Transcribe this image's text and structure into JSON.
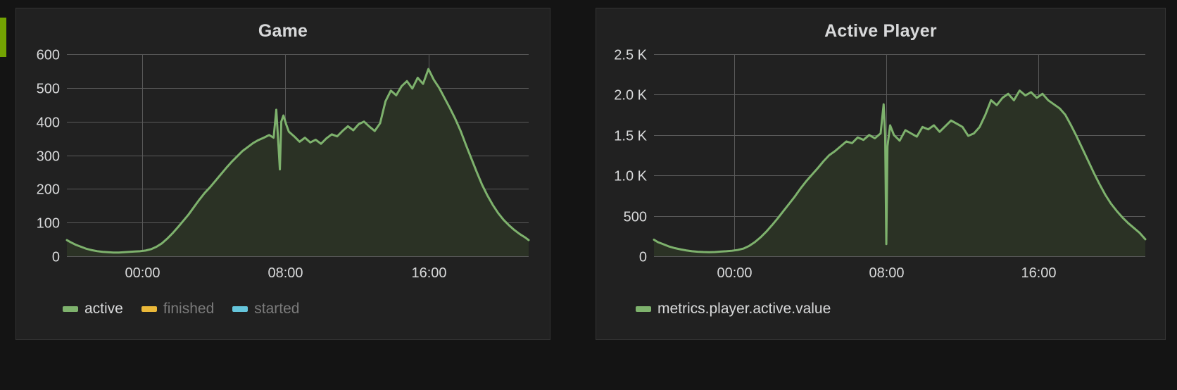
{
  "theme": {
    "page_background": "#141414",
    "panel_background": "#212121",
    "panel_border": "#343434",
    "accent_bar_color": "#73a302",
    "text_primary": "#d8d9da",
    "text_dimmed": "#7b7b7b",
    "grid_color": "#5a5a5a"
  },
  "panels": [
    {
      "id": "game",
      "title": "Game",
      "legend": [
        {
          "label": "active",
          "color": "#7eb26d",
          "enabled": true
        },
        {
          "label": "finished",
          "color": "#eab839",
          "enabled": false
        },
        {
          "label": "started",
          "color": "#65c5db",
          "enabled": false
        }
      ]
    },
    {
      "id": "active-player",
      "title": "Active Player",
      "legend": [
        {
          "label": "metrics.player.active.value",
          "color": "#7eb26d",
          "enabled": true
        }
      ]
    }
  ],
  "chart_data": [
    {
      "type": "area",
      "panel": "game",
      "title": "Game",
      "xlabel": "",
      "ylabel": "",
      "grid": true,
      "legend_position": "bottom",
      "ylim": [
        0,
        600
      ],
      "yticks": [
        0,
        100,
        200,
        300,
        400,
        500,
        600
      ],
      "yticklabels": [
        "0",
        "100",
        "200",
        "300",
        "400",
        "500",
        "600"
      ],
      "xlim": [
        -4.2,
        21.6
      ],
      "xticks": [
        0,
        8,
        16
      ],
      "xticklabels": [
        "00:00",
        "08:00",
        "16:00"
      ],
      "series": [
        {
          "name": "active",
          "color": "#7eb26d",
          "fill": "#2b3225",
          "x": [
            -4.2,
            -4.0,
            -3.7,
            -3.4,
            -3.1,
            -2.8,
            -2.5,
            -2.2,
            -1.9,
            -1.6,
            -1.3,
            -1.0,
            -0.7,
            -0.4,
            -0.1,
            0.2,
            0.5,
            0.8,
            1.1,
            1.4,
            1.7,
            2.0,
            2.3,
            2.6,
            2.9,
            3.2,
            3.5,
            3.8,
            4.1,
            4.4,
            4.7,
            5.0,
            5.3,
            5.6,
            5.9,
            6.2,
            6.5,
            6.8,
            7.1,
            7.35,
            7.5,
            7.62,
            7.7,
            7.78,
            7.9,
            8.05,
            8.2,
            8.5,
            8.8,
            9.1,
            9.4,
            9.7,
            10.0,
            10.3,
            10.6,
            10.9,
            11.2,
            11.5,
            11.8,
            12.1,
            12.4,
            12.7,
            13.0,
            13.3,
            13.6,
            13.9,
            14.2,
            14.5,
            14.8,
            15.1,
            15.4,
            15.7,
            16.0,
            16.3,
            16.6,
            16.9,
            17.2,
            17.5,
            17.8,
            18.1,
            18.4,
            18.7,
            19.0,
            19.3,
            19.6,
            19.9,
            20.2,
            20.5,
            20.8,
            21.1,
            21.4,
            21.6
          ],
          "y": [
            48,
            42,
            34,
            28,
            22,
            18,
            15,
            13,
            12,
            11,
            11,
            12,
            13,
            14,
            15,
            17,
            21,
            28,
            38,
            52,
            68,
            86,
            105,
            124,
            146,
            168,
            188,
            205,
            224,
            243,
            262,
            280,
            296,
            312,
            324,
            336,
            345,
            352,
            360,
            352,
            435,
            330,
            258,
            400,
            418,
            392,
            370,
            356,
            340,
            352,
            338,
            346,
            334,
            350,
            362,
            356,
            372,
            386,
            374,
            392,
            400,
            385,
            372,
            395,
            460,
            492,
            478,
            505,
            520,
            498,
            530,
            512,
            556,
            524,
            500,
            470,
            440,
            408,
            372,
            330,
            290,
            250,
            212,
            180,
            152,
            128,
            108,
            92,
            78,
            66,
            56,
            48
          ]
        }
      ]
    },
    {
      "type": "area",
      "panel": "active-player",
      "title": "Active Player",
      "xlabel": "",
      "ylabel": "",
      "grid": true,
      "legend_position": "bottom",
      "ylim": [
        0,
        2500
      ],
      "yticks": [
        0,
        500,
        1000,
        1500,
        2000,
        2500
      ],
      "yticklabels": [
        "0",
        "500",
        "1.0 K",
        "1.5 K",
        "2.0 K",
        "2.5 K"
      ],
      "xlim": [
        -4.2,
        21.6
      ],
      "xticks": [
        0,
        8,
        16
      ],
      "xticklabels": [
        "00:00",
        "08:00",
        "16:00"
      ],
      "series": [
        {
          "name": "metrics.player.active.value",
          "color": "#7eb26d",
          "fill": "#2b3225",
          "x": [
            -4.2,
            -4.0,
            -3.7,
            -3.4,
            -3.1,
            -2.8,
            -2.5,
            -2.2,
            -1.9,
            -1.6,
            -1.3,
            -1.0,
            -0.7,
            -0.4,
            -0.1,
            0.2,
            0.5,
            0.8,
            1.1,
            1.4,
            1.7,
            2.0,
            2.3,
            2.6,
            2.9,
            3.2,
            3.5,
            3.8,
            4.1,
            4.4,
            4.7,
            5.0,
            5.3,
            5.6,
            5.9,
            6.2,
            6.5,
            6.8,
            7.1,
            7.4,
            7.7,
            7.86,
            7.94,
            8.0,
            8.06,
            8.2,
            8.4,
            8.7,
            9.0,
            9.3,
            9.6,
            9.9,
            10.2,
            10.5,
            10.8,
            11.1,
            11.4,
            11.7,
            12.0,
            12.3,
            12.6,
            12.9,
            13.2,
            13.5,
            13.8,
            14.1,
            14.4,
            14.7,
            15.0,
            15.3,
            15.6,
            15.9,
            16.2,
            16.5,
            16.8,
            17.1,
            17.4,
            17.7,
            18.0,
            18.3,
            18.6,
            18.9,
            19.2,
            19.5,
            19.8,
            20.1,
            20.4,
            20.7,
            21.0,
            21.3,
            21.6
          ],
          "y": [
            205,
            175,
            148,
            120,
            100,
            85,
            72,
            62,
            56,
            52,
            50,
            52,
            58,
            62,
            68,
            78,
            95,
            128,
            175,
            235,
            305,
            385,
            470,
            560,
            650,
            740,
            840,
            930,
            1010,
            1090,
            1175,
            1250,
            1300,
            1360,
            1420,
            1400,
            1470,
            1440,
            1500,
            1460,
            1520,
            1880,
            1500,
            150,
            1360,
            1620,
            1500,
            1430,
            1560,
            1520,
            1480,
            1600,
            1570,
            1620,
            1540,
            1610,
            1680,
            1640,
            1600,
            1490,
            1520,
            1600,
            1750,
            1930,
            1870,
            1960,
            2010,
            1930,
            2050,
            1990,
            2030,
            1960,
            2010,
            1930,
            1880,
            1830,
            1750,
            1620,
            1480,
            1330,
            1180,
            1030,
            890,
            760,
            650,
            560,
            480,
            410,
            350,
            290,
            210
          ]
        }
      ]
    }
  ]
}
